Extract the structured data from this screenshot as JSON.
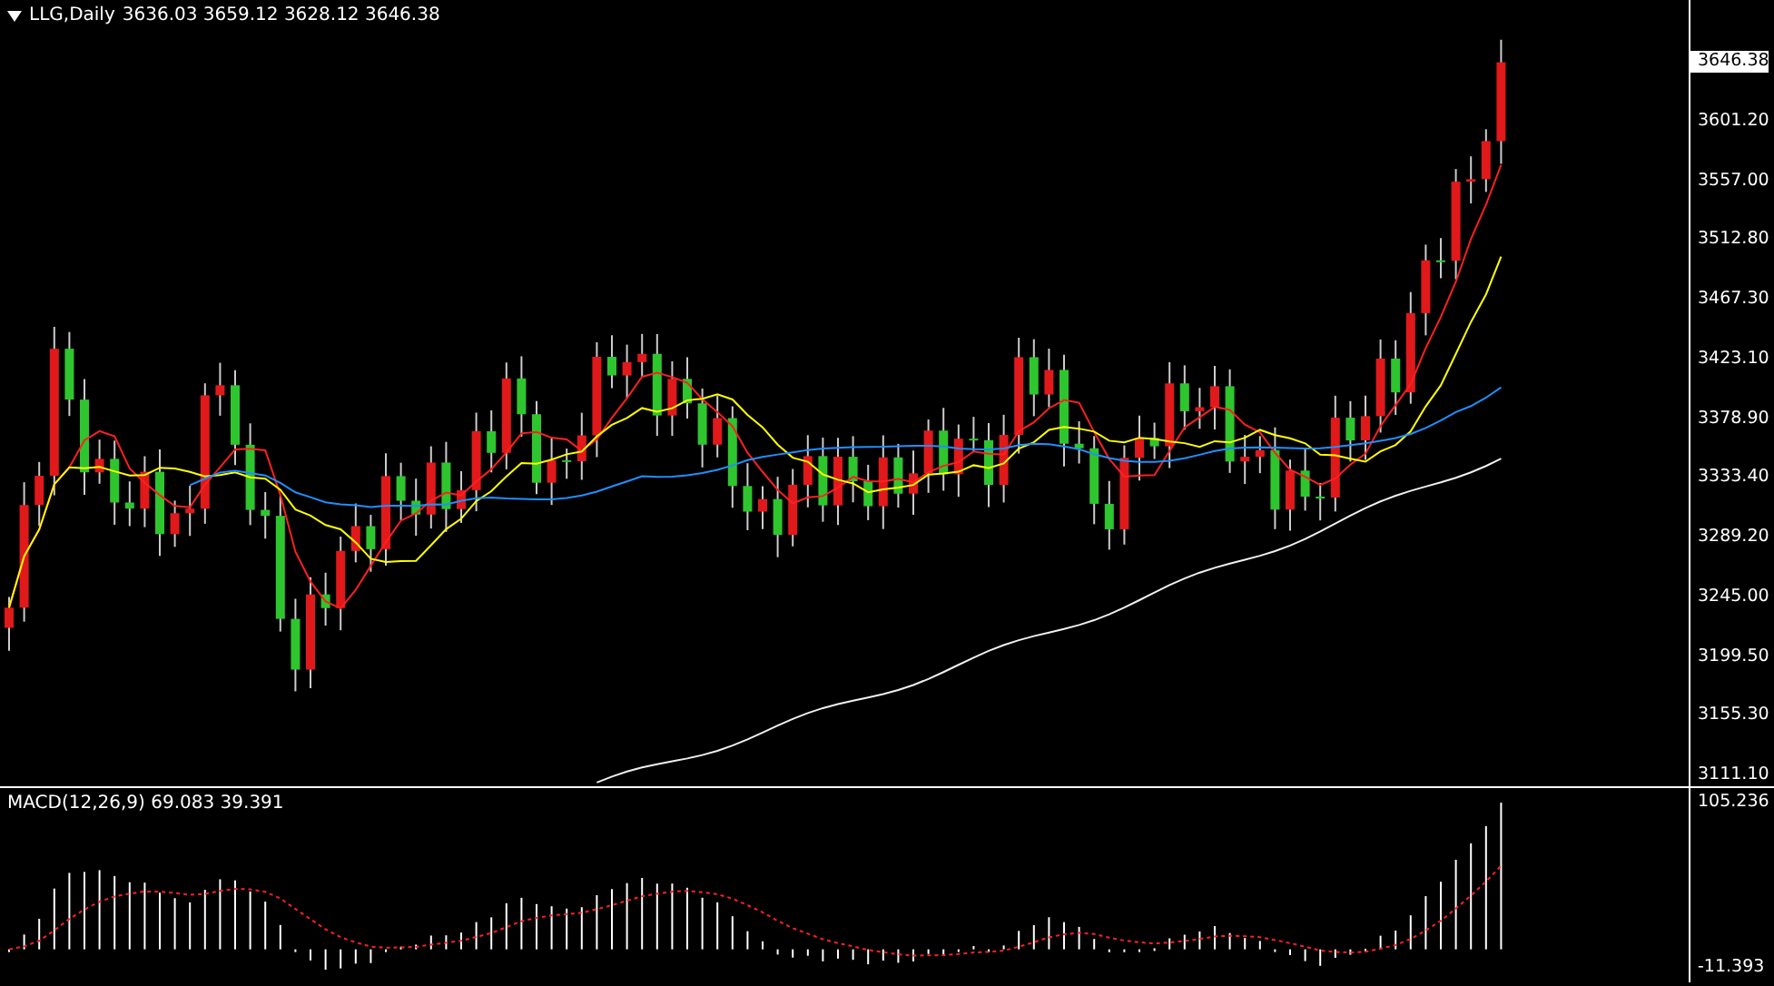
{
  "header": {
    "title": "LLG,Daily",
    "values": [
      "3636.03",
      "3659.12",
      "3628.12",
      "3646.38"
    ]
  },
  "price_axis": {
    "current": "3646.38",
    "labels": [
      "3601.20",
      "3557.00",
      "3512.80",
      "3467.30",
      "3423.10",
      "3378.90",
      "3333.40",
      "3289.20",
      "3245.00",
      "3199.50",
      "3155.30",
      "3111.10"
    ]
  },
  "macd": {
    "title": "MACD(12,26,9)",
    "values": [
      "69.083",
      "39.391"
    ],
    "axis_labels": [
      "105.236",
      "-11.393"
    ]
  }
}
